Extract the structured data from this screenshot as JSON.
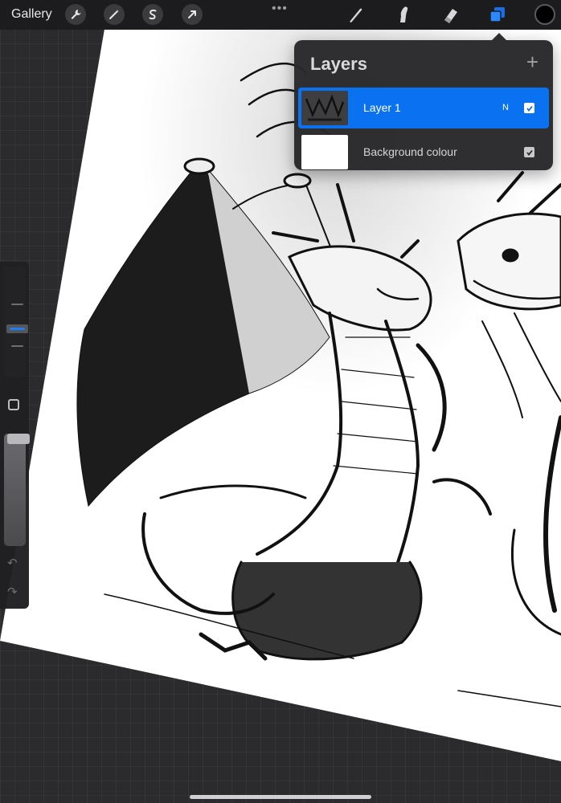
{
  "app": {
    "gallery_label": "Gallery",
    "more_dots": "•••",
    "current_color": "#000000"
  },
  "toolbar_left": [
    {
      "name": "actions",
      "icon": "wrench-icon"
    },
    {
      "name": "adjustments",
      "icon": "magic-wand-icon"
    },
    {
      "name": "selection",
      "icon": "selection-s-icon"
    },
    {
      "name": "transform",
      "icon": "arrow-cursor-icon"
    }
  ],
  "toolbar_right": [
    {
      "name": "brush",
      "icon": "paintbrush-icon"
    },
    {
      "name": "smudge",
      "icon": "smudge-icon"
    },
    {
      "name": "eraser",
      "icon": "eraser-icon"
    },
    {
      "name": "layers",
      "icon": "layers-icon",
      "active": true
    }
  ],
  "layers_panel": {
    "title": "Layers",
    "add_label": "+",
    "layers": [
      {
        "name": "Layer 1",
        "blend_mode": "N",
        "visible": true,
        "selected": true
      },
      {
        "name": "Background colour",
        "visible": true,
        "selected": false
      }
    ]
  },
  "sidebar": {
    "brush_size_level": 0.3,
    "brush_opacity_level": 1.0
  },
  "colors": {
    "accent": "#0a72f0",
    "panel": "#28282a",
    "canvas_bg": "#2b2b2d"
  }
}
